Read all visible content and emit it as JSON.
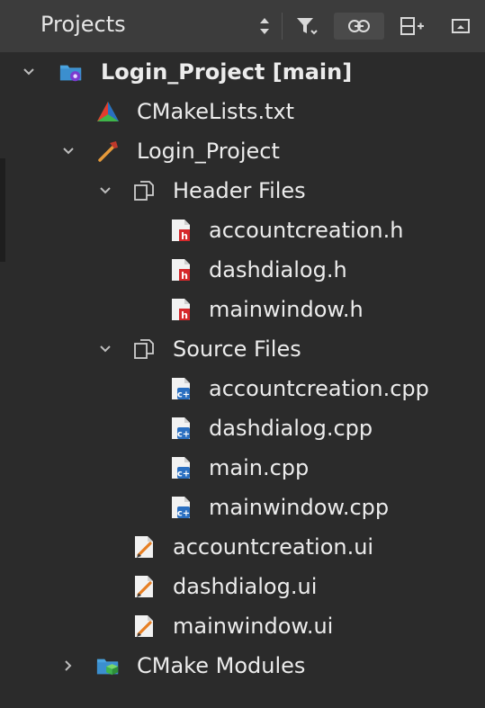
{
  "header": {
    "title": "Projects"
  },
  "tree": [
    {
      "label": "Login_Project [main]",
      "bold": true,
      "icon": "cmake-project-folder-icon",
      "expanded": true
    },
    {
      "label": "CMakeLists.txt",
      "icon": "cmake-file-icon"
    },
    {
      "label": "Login_Project",
      "icon": "hammer-build-icon",
      "expanded": true
    },
    {
      "label": "Header Files",
      "icon": "virtual-folder-icon",
      "expanded": true
    },
    {
      "label": "accountcreation.h",
      "icon": "header-file-icon"
    },
    {
      "label": "dashdialog.h",
      "icon": "header-file-icon"
    },
    {
      "label": "mainwindow.h",
      "icon": "header-file-icon"
    },
    {
      "label": "Source Files",
      "icon": "virtual-folder-icon",
      "expanded": true
    },
    {
      "label": "accountcreation.cpp",
      "icon": "cpp-file-icon"
    },
    {
      "label": "dashdialog.cpp",
      "icon": "cpp-file-icon"
    },
    {
      "label": "main.cpp",
      "icon": "cpp-file-icon"
    },
    {
      "label": "mainwindow.cpp",
      "icon": "cpp-file-icon"
    },
    {
      "label": "accountcreation.ui",
      "icon": "ui-form-file-icon"
    },
    {
      "label": "dashdialog.ui",
      "icon": "ui-form-file-icon"
    },
    {
      "label": "mainwindow.ui",
      "icon": "ui-form-file-icon"
    },
    {
      "label": "CMake Modules",
      "icon": "cmake-modules-folder-icon",
      "expanded": false
    }
  ],
  "colors": {
    "background": "#2b2b2b",
    "header": "#3c3c3c",
    "text": "#ececec",
    "header_file_red": "#d6282b",
    "cpp_blue": "#2a6fc1",
    "folder_blue": "#4aa3df",
    "cmake_green": "#3fb54a"
  }
}
